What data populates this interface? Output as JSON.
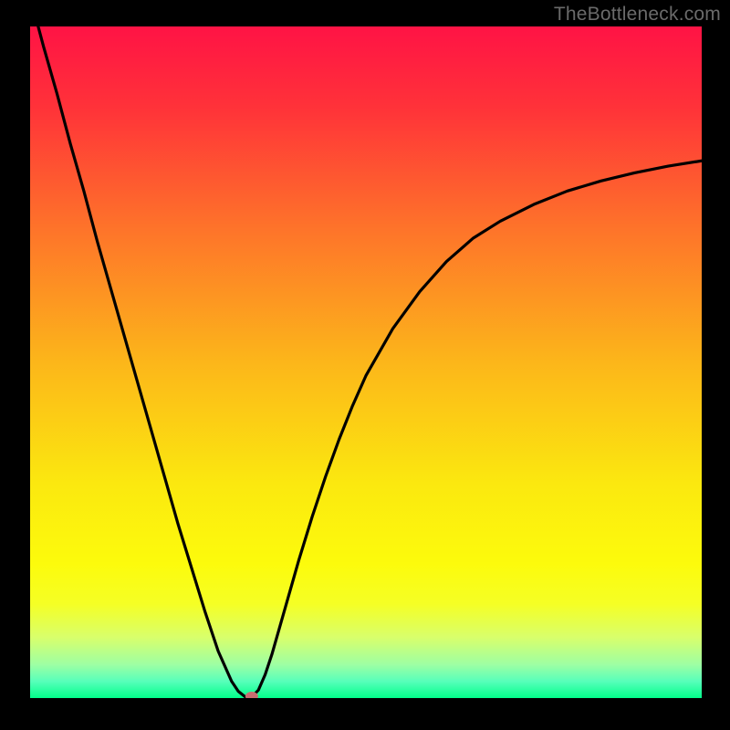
{
  "watermark": "TheBottleneck.com",
  "chart_data": {
    "type": "line",
    "title": "",
    "xlabel": "",
    "ylabel": "",
    "xlim": [
      0,
      100
    ],
    "ylim": [
      0,
      100
    ],
    "background": {
      "type": "vertical-gradient",
      "stops": [
        {
          "offset": 0.0,
          "color": "#ff1345"
        },
        {
          "offset": 0.12,
          "color": "#ff3239"
        },
        {
          "offset": 0.3,
          "color": "#fe732a"
        },
        {
          "offset": 0.5,
          "color": "#fcb61a"
        },
        {
          "offset": 0.68,
          "color": "#fbe80f"
        },
        {
          "offset": 0.8,
          "color": "#fcfb0c"
        },
        {
          "offset": 0.86,
          "color": "#f5ff25"
        },
        {
          "offset": 0.91,
          "color": "#d8ff6c"
        },
        {
          "offset": 0.95,
          "color": "#9effa3"
        },
        {
          "offset": 0.975,
          "color": "#58ffba"
        },
        {
          "offset": 1.0,
          "color": "#02ff8a"
        }
      ]
    },
    "series": [
      {
        "name": "bottleneck-curve",
        "color": "#000000",
        "x": [
          0,
          2,
          4,
          6,
          8,
          10,
          12,
          14,
          16,
          18,
          20,
          22,
          24,
          26,
          28,
          30,
          31,
          32,
          33,
          34,
          35,
          36,
          38,
          40,
          42,
          44,
          46,
          48,
          50,
          54,
          58,
          62,
          66,
          70,
          75,
          80,
          85,
          90,
          95,
          100
        ],
        "y": [
          104.5,
          97.0,
          90.0,
          82.5,
          75.5,
          68.0,
          61.0,
          54.0,
          47.0,
          40.0,
          33.0,
          26.0,
          19.5,
          13.0,
          7.0,
          2.5,
          1.0,
          0.2,
          0.15,
          1.2,
          3.5,
          6.5,
          13.5,
          20.5,
          27.0,
          33.0,
          38.5,
          43.5,
          48.0,
          55.0,
          60.5,
          65.0,
          68.5,
          71.0,
          73.5,
          75.5,
          77.0,
          78.2,
          79.2,
          80.0
        ]
      }
    ],
    "marker": {
      "x": 33,
      "y": 0.0,
      "color": "#c86d70",
      "rx": 7,
      "ry": 5
    }
  }
}
